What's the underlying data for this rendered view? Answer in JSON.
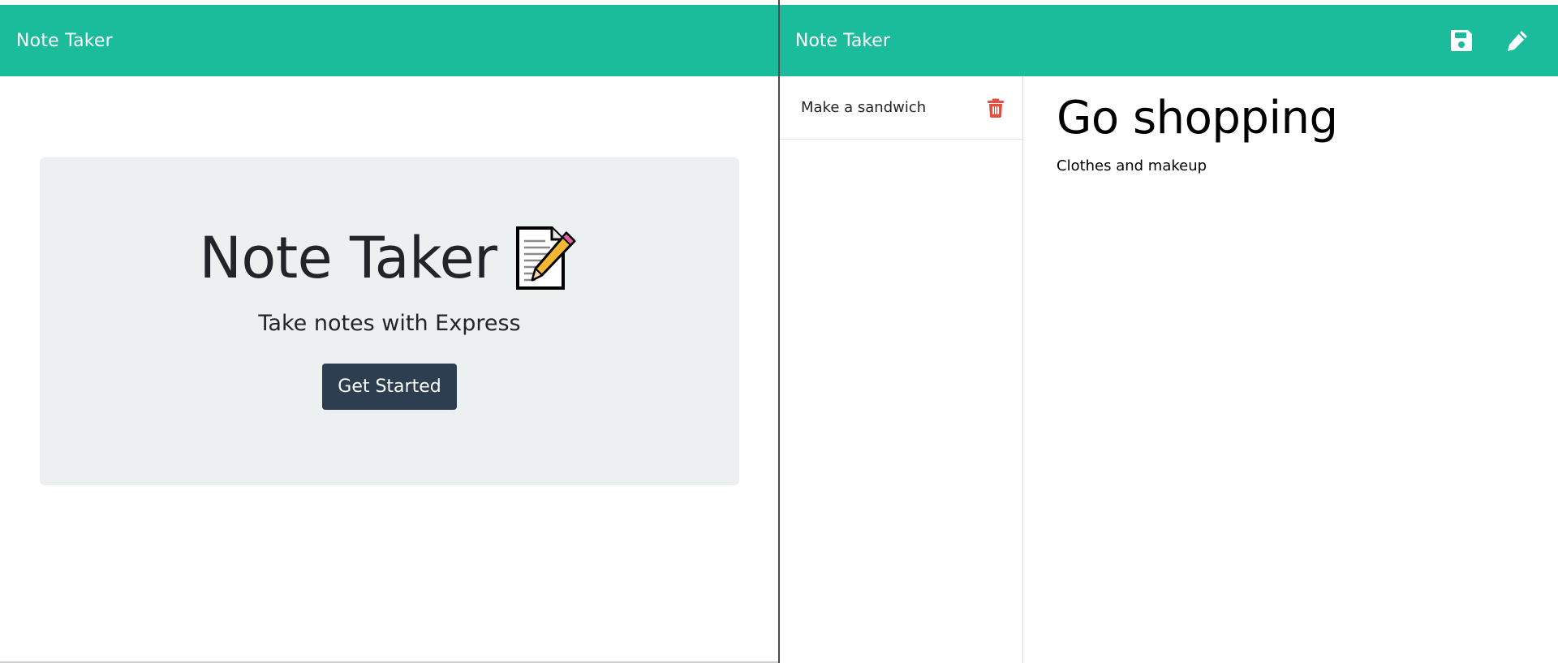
{
  "landing": {
    "brand": "Note Taker",
    "jumbotron": {
      "title": "Note Taker",
      "icon": "memo-icon",
      "subtitle": "Take notes with Express",
      "cta_label": "Get Started"
    }
  },
  "notes_page": {
    "brand": "Note Taker",
    "toolbar": {
      "save_icon": "floppy-disk-save-icon",
      "new_note_icon": "pencil-icon"
    },
    "list": [
      {
        "title": "Make a sandwich",
        "delete_icon": "trash-icon"
      }
    ],
    "active_note": {
      "title": "Go shopping",
      "text": "Clothes and makeup"
    }
  },
  "colors": {
    "navbar": "#1abc9c",
    "jumbotron_bg": "#ecf0f1",
    "button_bg": "#2c3e50",
    "delete_icon": "#e74c3c",
    "text": "#212529"
  }
}
